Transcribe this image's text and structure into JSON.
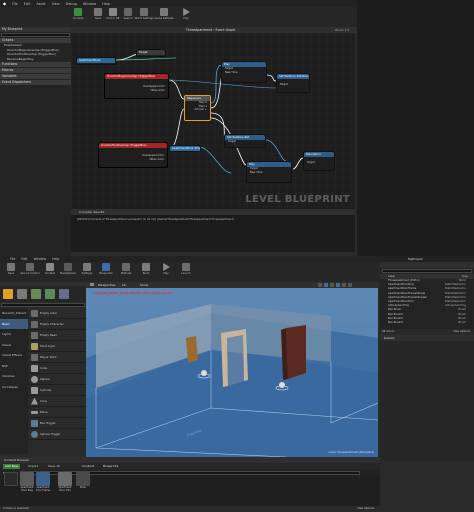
{
  "blueprint": {
    "menu": [
      "File",
      "Edit",
      "Asset",
      "View",
      "Debug",
      "Window",
      "Help"
    ],
    "toolbar": [
      "Compile",
      "Save",
      "Find in CB",
      "Search",
      "World Settings",
      "Game Defaults",
      "Play"
    ],
    "left": {
      "header": "My Blueprint",
      "sections": [
        "Graphs",
        "Functions",
        "Macros",
        "Variables",
        "Event Dispatchers"
      ],
      "graphs": [
        "EventGraph",
        "OnActorBeginOverlap (TriggerBox)",
        "OnActorEndOverlap (TriggerBox)",
        "ReceiveBeginPlay"
      ]
    },
    "graph": {
      "breadcrumb": "ThreeApartment › Event Graph",
      "zoom": "Zoom 1:1",
      "watermark": "LEVEL BLUEPRINT",
      "nodes": [
        {
          "title": "ApartmentDoor"
        },
        {
          "title": "Target"
        },
        {
          "title": "OnActorBeginOverlap (TriggerBox)",
          "pins": [
            "Overlapped Actor",
            "Other Actor"
          ]
        },
        {
          "title": "Sequence",
          "pins": [
            "Then 0",
            "Then 1",
            "Add pin +"
          ]
        },
        {
          "title": "Play",
          "pins": [
            "Target",
            "New Time"
          ]
        },
        {
          "title": "Set Relative Rotation",
          "pins": [
            "Target"
          ]
        },
        {
          "title": "OnActorEndOverlap (TriggerBox)",
          "pins": [
            "Overlapped Actor",
            "Other Actor"
          ]
        },
        {
          "title": "ApartmentDoor Ping"
        },
        {
          "title": "Set Relative Rot",
          "pins": [
            "Target"
          ]
        },
        {
          "title": "Play",
          "pins": [
            "Target",
            "New Time"
          ]
        },
        {
          "title": "Relocation",
          "pins": [
            "Target"
          ]
        }
      ]
    },
    "compiler": {
      "tab": "Compiler Results",
      "line": "[0019.03] Compile of ThreeApartment successful! [in 44 ms] (/Game/ThreeApartment/ThreeApartment.ThreeApartment)"
    }
  },
  "level": {
    "menu": [
      "File",
      "Edit",
      "Window",
      "Help"
    ],
    "project": "MyProject",
    "toolbar": [
      "Save",
      "Source Control",
      "Content",
      "Marketplace",
      "Settings",
      "Blueprints",
      "Matinee",
      "Build",
      "Play",
      "Launch"
    ],
    "place": {
      "categories": [
        "Recently Placed",
        "Basic",
        "Lights",
        "Visual",
        "Visual Effects",
        "BSP",
        "Volumes",
        "All Classes"
      ],
      "items": [
        "Empty Actor",
        "Empty Character",
        "Empty Pawn",
        "Point Light",
        "Player Start",
        "Cube",
        "Sphere",
        "Cylinder",
        "Cone",
        "Plane",
        "Box Trigger",
        "Sphere Trigger"
      ]
    },
    "viewport": {
      "perspective": "Perspective",
      "lit": "Lit",
      "show": "Show",
      "warning": "LIGHTING NEEDS TO BE REBUILT (368 unbuilt objects)",
      "level_name": "Level: ThreeApartment (Persistent)",
      "overlay": "TriggerBox"
    },
    "outliner": {
      "col_label": "Label",
      "col_type": "Type",
      "rows": [
        {
          "label": "ThreeApartment (Editor)",
          "type": "World"
        },
        {
          "label": "ApartmentDoorPing",
          "type": "StaticMeshActor"
        },
        {
          "label": "ApartmentDoorFrame",
          "type": "StaticMeshActor"
        },
        {
          "label": "ApartmentDoorFrameSimple",
          "type": "StaticMeshActor"
        },
        {
          "label": "ApartmentDoorFrameSimple2",
          "type": "StaticMeshActor"
        },
        {
          "label": "ApartmentDoorTrim",
          "type": "StaticMeshActor"
        },
        {
          "label": "AtmosphericFog",
          "type": "AtmosphericFog"
        },
        {
          "label": "Box Brush",
          "type": "Brush"
        },
        {
          "label": "Box Brush2",
          "type": "Brush"
        },
        {
          "label": "Box Brush3",
          "type": "Brush"
        },
        {
          "label": "Box Brush4",
          "type": "Brush"
        }
      ],
      "count": "28 actors",
      "view_options": "View Options"
    },
    "details": {
      "tab": "Details"
    },
    "content": {
      "tab": "Content Browser",
      "add_new": "Add New",
      "import": "Import",
      "save_all": "Save All",
      "breadcrumb": [
        "Content",
        "Blueprints"
      ],
      "filters": "Filters",
      "assets": [
        "",
        "Apartment Door Ping",
        "Apartment Door Frame",
        "Apartment Door Trim",
        "Chair"
      ],
      "status": "5 items (1 selected)",
      "view_options": "View Options"
    }
  }
}
